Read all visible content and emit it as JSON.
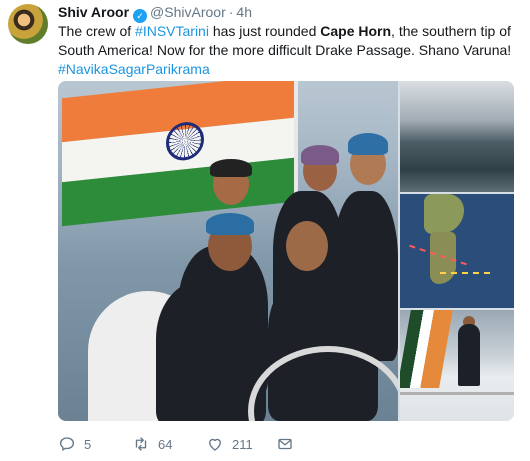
{
  "tweet": {
    "display_name": "Shiv Aroor",
    "verified": true,
    "handle": "@ShivAroor",
    "separator": "·",
    "time": "4h",
    "text_parts": {
      "p1": "The crew of ",
      "mention": "#INSVTarini",
      "p2": " has just rounded ",
      "bold": "Cape Horn",
      "p3": ", the southern tip of South America! Now for the more difficult Drake Passage. Shano Varuna!",
      "hashtag": "#NavikaSagarParikrama"
    },
    "media": {
      "photos": [
        "crew-with-flag",
        "stormy-waves",
        "route-map",
        "crew-on-deck"
      ]
    },
    "actions": {
      "reply_count": "5",
      "retweet_count": "64",
      "like_count": "211"
    }
  },
  "colors": {
    "link": "#1b95e0",
    "verified": "#1da1f2",
    "muted": "#657786",
    "text": "#14171a"
  }
}
